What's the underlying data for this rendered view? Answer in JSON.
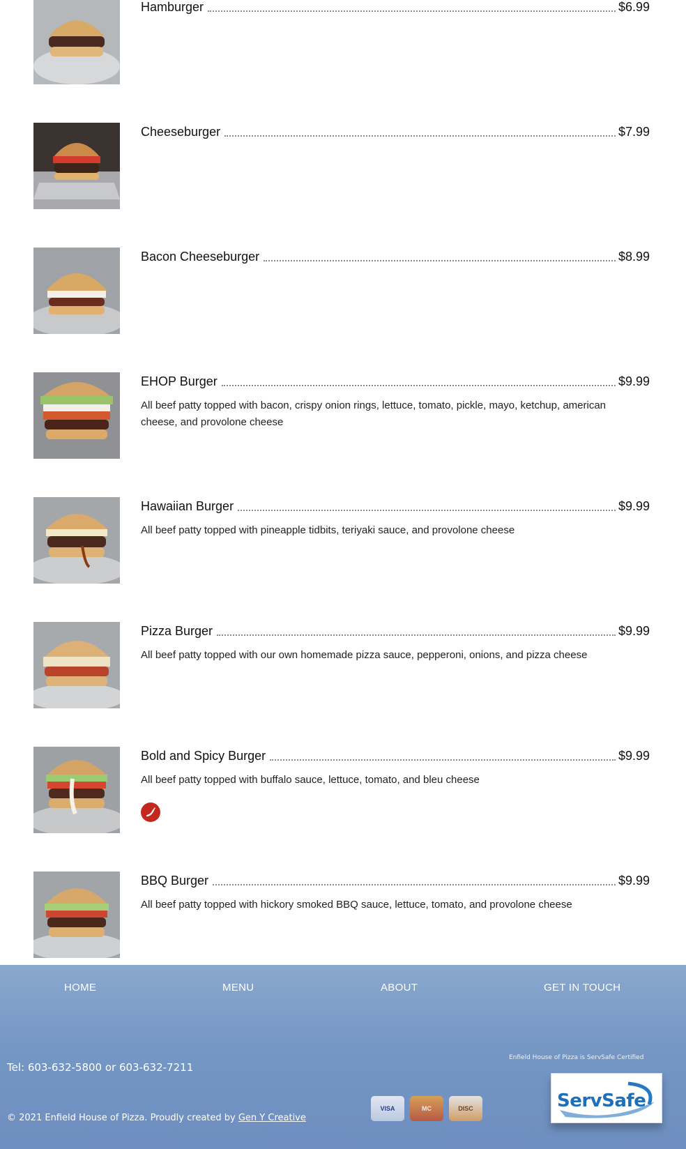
{
  "menu_items": [
    {
      "name": "Hamburger",
      "price": "$6.99",
      "description": "",
      "image_alt": "hamburger-photo"
    },
    {
      "name": "Cheeseburger",
      "price": "$7.99",
      "description": "",
      "image_alt": "cheeseburger-photo"
    },
    {
      "name": "Bacon Cheeseburger",
      "price": "$8.99",
      "description": "",
      "image_alt": "bacon-cheeseburger-photo"
    },
    {
      "name": "EHOP Burger",
      "price": "$9.99",
      "description": "All beef patty topped with bacon, crispy onion rings, lettuce, tomato, pickle, mayo, ketchup, american cheese, and provolone cheese",
      "image_alt": "ehop-burger-photo"
    },
    {
      "name": "Hawaiian Burger",
      "price": "$9.99",
      "description": "All beef patty topped with pineapple tidbits, teriyaki sauce, and provolone cheese",
      "image_alt": "hawaiian-burger-photo"
    },
    {
      "name": "Pizza Burger",
      "price": "$9.99",
      "description": "All beef patty topped with our own homemade pizza sauce, pepperoni, onions, and pizza cheese",
      "image_alt": "pizza-burger-photo"
    },
    {
      "name": "Bold and Spicy Burger",
      "price": "$9.99",
      "description": "All beef patty topped with buffalo sauce, lettuce, tomato, and bleu cheese",
      "image_alt": "bold-and-spicy-burger-photo",
      "badge_icon": "chili-pepper-icon"
    },
    {
      "name": "BBQ Burger",
      "price": "$9.99",
      "description": "All beef patty topped with hickory smoked BBQ sauce, lettuce, tomato, and provolone cheese",
      "image_alt": "bbq-burger-photo"
    }
  ],
  "footer": {
    "nav": [
      "HOME",
      "MENU",
      "ABOUT",
      "GET IN TOUCH"
    ],
    "tel": "Tel: 603-632-5800 or 603-632-7211",
    "copyright": "© 2021  Enfield House of Pizza. Proudly created by",
    "credit_link": "Gen Y Creative",
    "servsafe_note": "Enfield House of Pizza is ServSafe Certified",
    "servsafe_logo_text": "ServSafe",
    "cards": [
      "VISA",
      "MC",
      "DISC"
    ]
  },
  "colors": {
    "footer_top": "#8aa8cd",
    "footer_bottom": "#6d8ec0",
    "spicy_badge": "#c4281c",
    "servsafe_blue": "#1f6fb8"
  }
}
